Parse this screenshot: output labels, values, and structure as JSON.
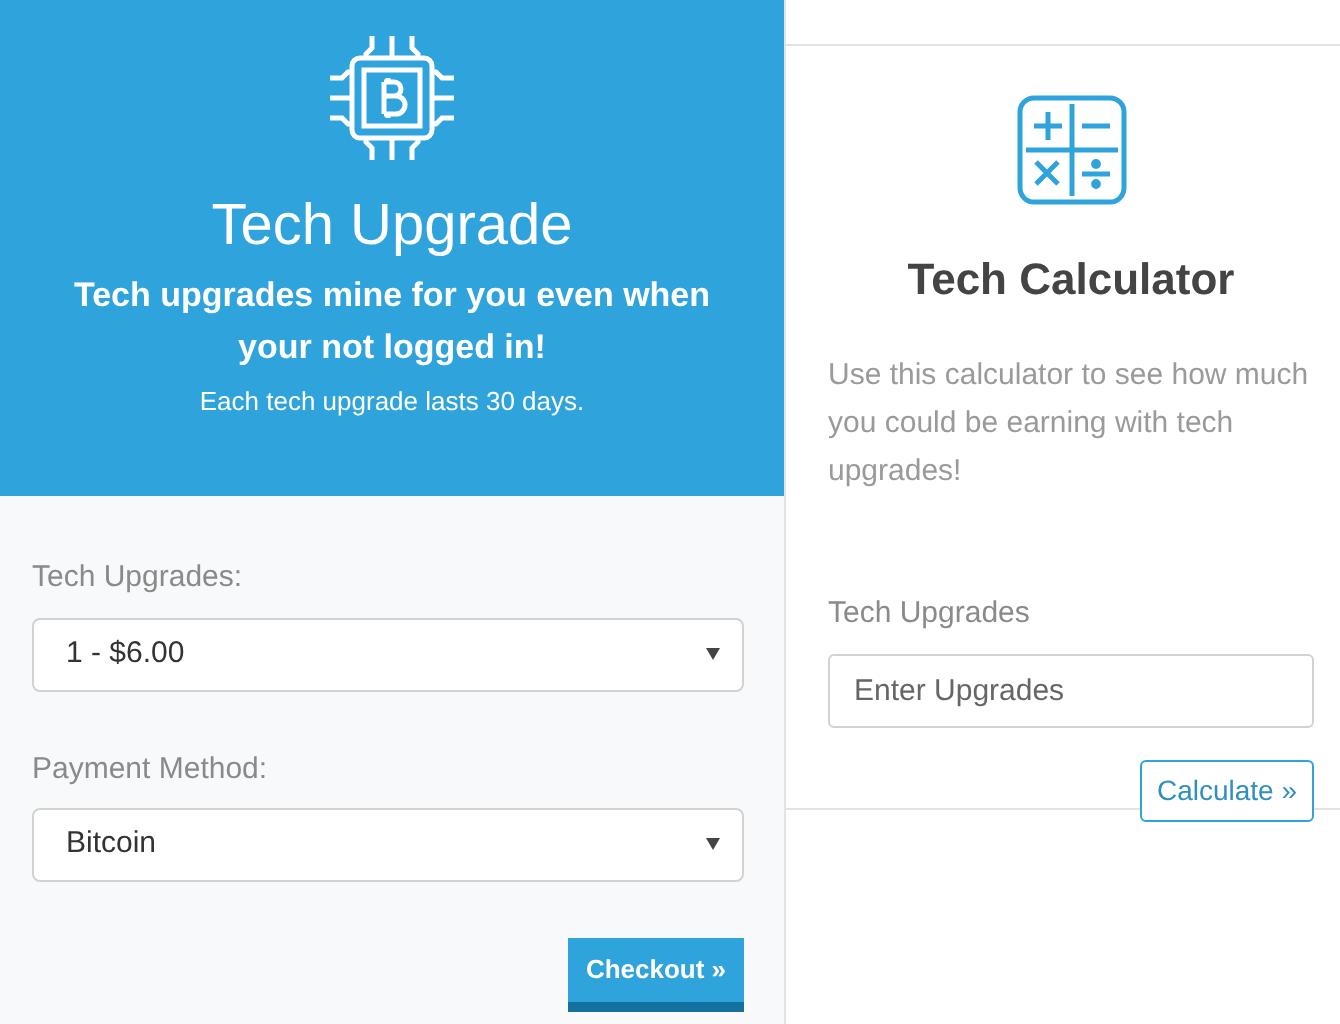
{
  "upgrade_panel": {
    "title": "Tech Upgrade",
    "subtitle": "Tech upgrades mine for you even when your not logged in!",
    "note": "Each tech upgrade lasts 30 days.",
    "fields": [
      {
        "label": "Tech Upgrades:",
        "value": "1 - $6.00"
      },
      {
        "label": "Payment Method:",
        "value": "Bitcoin"
      }
    ],
    "button": "Checkout »"
  },
  "calculator": {
    "title": "Tech Calculator",
    "description": "Use this calculator to see how much you could be earning with tech upgrades!",
    "field_label": "Tech Upgrades",
    "placeholder": "Enter Upgrades",
    "button": "Calculate »"
  }
}
